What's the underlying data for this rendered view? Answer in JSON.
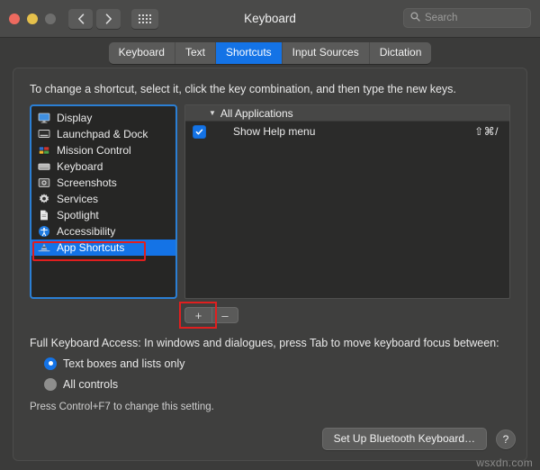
{
  "window": {
    "title": "Keyboard",
    "traffic_lights": [
      "close",
      "minimize",
      "zoom"
    ]
  },
  "toolbar": {
    "back_icon": "chevron-left-icon",
    "forward_icon": "chevron-right-icon",
    "grid_icon": "all-preferences-grid-icon",
    "search": {
      "placeholder": "Search",
      "value": "",
      "icon": "search-icon"
    }
  },
  "tabs": [
    {
      "label": "Keyboard",
      "active": false
    },
    {
      "label": "Text",
      "active": false
    },
    {
      "label": "Shortcuts",
      "active": true
    },
    {
      "label": "Input Sources",
      "active": false
    },
    {
      "label": "Dictation",
      "active": false
    }
  ],
  "main": {
    "instruction": "To change a shortcut, select it, click the key combination, and then type the new keys.",
    "categories": [
      {
        "label": "Display",
        "icon": "display-icon",
        "selected": false
      },
      {
        "label": "Launchpad & Dock",
        "icon": "launchpad-dock-icon",
        "selected": false
      },
      {
        "label": "Mission Control",
        "icon": "mission-control-icon",
        "selected": false
      },
      {
        "label": "Keyboard",
        "icon": "keyboard-icon",
        "selected": false
      },
      {
        "label": "Screenshots",
        "icon": "screenshots-icon",
        "selected": false
      },
      {
        "label": "Services",
        "icon": "services-gear-icon",
        "selected": false
      },
      {
        "label": "Spotlight",
        "icon": "spotlight-icon",
        "selected": false
      },
      {
        "label": "Accessibility",
        "icon": "accessibility-icon",
        "selected": false
      },
      {
        "label": "App Shortcuts",
        "icon": "app-shortcuts-icon",
        "selected": true
      }
    ],
    "shortcut_group": {
      "label": "All Applications",
      "expanded": true,
      "disclosure_glyph": "▼"
    },
    "shortcuts": [
      {
        "checked": true,
        "name": "Show Help menu",
        "keys": "⇧⌘/"
      }
    ],
    "add_button": {
      "label": "+",
      "icon": "plus-icon"
    },
    "remove_button": {
      "label": "–",
      "icon": "minus-icon"
    }
  },
  "full_keyboard_access": {
    "title": "Full Keyboard Access: In windows and dialogues, press Tab to move keyboard focus between:",
    "options": [
      {
        "label": "Text boxes and lists only",
        "selected": true
      },
      {
        "label": "All controls",
        "selected": false
      }
    ],
    "note": "Press Control+F7 to change this setting."
  },
  "footer": {
    "bluetooth_button": "Set Up Bluetooth Keyboard…",
    "help_button": "?"
  },
  "watermark": "wsxdn.com",
  "colors": {
    "accent_blue": "#1473e6",
    "highlight_red": "#e01f1f",
    "window_bg": "#3b3b3a",
    "titlebar_bg": "#4a4a49",
    "list_bg": "#262625"
  }
}
